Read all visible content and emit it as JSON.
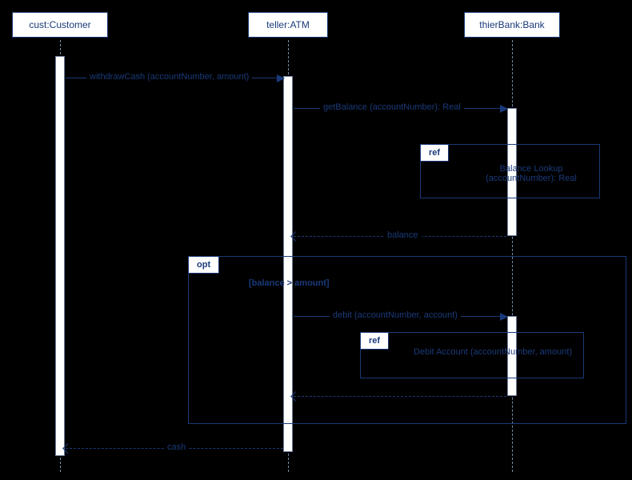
{
  "lifelines": {
    "customer": "cust:Customer",
    "atm": "teller:ATM",
    "bank": "thierBank:Bank"
  },
  "messages": {
    "withdraw": "withdrawCash (accountNumber, amount)",
    "getBalance": "getBalance (accountNumber): Real",
    "balance": "balance",
    "debit": "debit (accountNumber, account)",
    "cash": "cash"
  },
  "fragments": {
    "ref1": {
      "label": "ref",
      "text": "Balance Lookup (accountNumber): Real"
    },
    "opt": {
      "label": "opt",
      "guard": "[balance > amount]"
    },
    "ref2": {
      "label": "ref",
      "text": "Debit Account (accountNumber, amount)"
    }
  }
}
